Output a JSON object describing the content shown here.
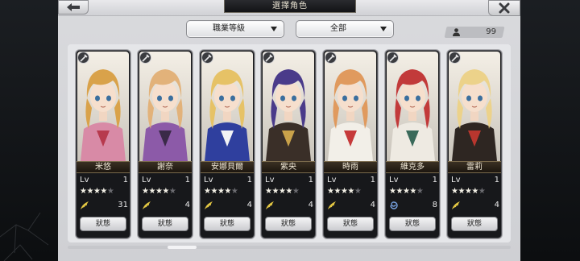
{
  "header": {
    "title": "選擇角色",
    "back_icon": "arrow-left-icon",
    "close_icon": "close-icon"
  },
  "filters": {
    "job_filter": "職業等級",
    "scope_filter": "全部"
  },
  "roster": {
    "count": "99",
    "count_icon": "person-icon"
  },
  "characters": [
    {
      "name": "米悠",
      "lv_label": "Lv",
      "level": "1",
      "stars": 4,
      "max_stars": 5,
      "bond_value": "31",
      "bond_icon": "wing-icon",
      "status_label": "狀態",
      "hair": "#d9a24a",
      "outfit": "#d88aa6",
      "accent": "#b73a4e"
    },
    {
      "name": "謝奈",
      "lv_label": "Lv",
      "level": "1",
      "stars": 4,
      "max_stars": 5,
      "bond_value": "4",
      "bond_icon": "wing-icon",
      "status_label": "狀態",
      "hair": "#e2b27a",
      "outfit": "#8c5aa8",
      "accent": "#3a2a48"
    },
    {
      "name": "安娜貝爾",
      "lv_label": "Lv",
      "level": "1",
      "stars": 4,
      "max_stars": 5,
      "bond_value": "4",
      "bond_icon": "wing-icon",
      "status_label": "狀態",
      "hair": "#e6c266",
      "outfit": "#2f3f9e",
      "accent": "#f2f2f5"
    },
    {
      "name": "紫央",
      "lv_label": "Lv",
      "level": "1",
      "stars": 4,
      "max_stars": 5,
      "bond_value": "4",
      "bond_icon": "wing-icon",
      "status_label": "狀態",
      "hair": "#4a3b8a",
      "outfit": "#3a2f28",
      "accent": "#c9a24a"
    },
    {
      "name": "時雨",
      "lv_label": "Lv",
      "level": "1",
      "stars": 4,
      "max_stars": 5,
      "bond_value": "4",
      "bond_icon": "wing-icon",
      "status_label": "狀態",
      "hair": "#e09a5e",
      "outfit": "#f2efe8",
      "accent": "#c63a3a"
    },
    {
      "name": "維克多",
      "lv_label": "Lv",
      "level": "1",
      "stars": 4,
      "max_stars": 5,
      "bond_value": "8",
      "bond_icon": "swirl-icon",
      "status_label": "狀態",
      "hair": "#c23a3a",
      "outfit": "#eeeae2",
      "accent": "#3a6a5a"
    },
    {
      "name": "雷莉",
      "lv_label": "Lv",
      "level": "1",
      "stars": 4,
      "max_stars": 5,
      "bond_value": "4",
      "bond_icon": "wing-icon",
      "status_label": "狀態",
      "hair": "#ecd28a",
      "outfit": "#2e2622",
      "accent": "#b8362e"
    }
  ]
}
